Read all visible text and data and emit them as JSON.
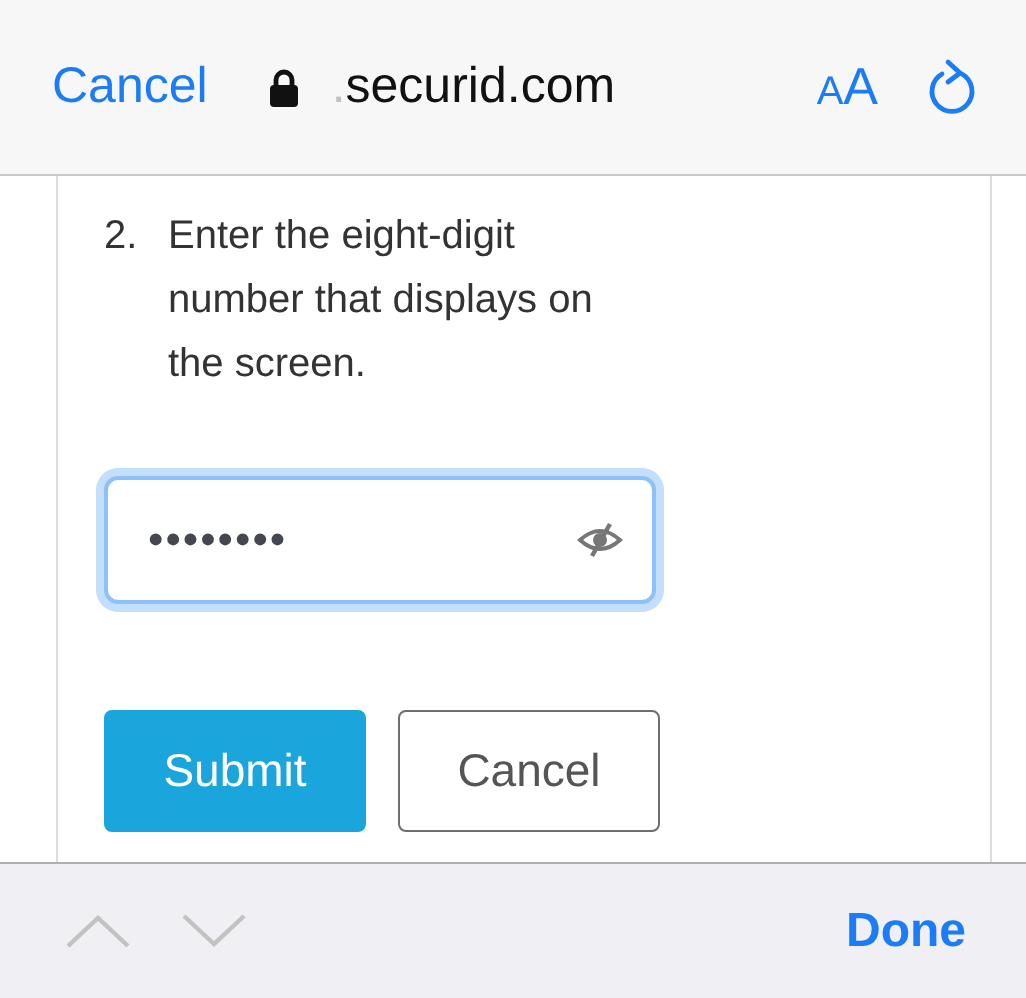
{
  "browser_bar": {
    "cancel": "Cancel",
    "domain_fade": ".",
    "domain": "securid.com",
    "text_size": {
      "small": "A",
      "large": "A"
    }
  },
  "step": {
    "number": "2.",
    "text": "Enter the eight-digit number that displays on the screen."
  },
  "password_field": {
    "value": "••••••••",
    "focused": true
  },
  "buttons": [
    {
      "label": "Submit",
      "kind": "primary"
    },
    {
      "label": "Cancel",
      "kind": "secondary"
    }
  ],
  "keyboard_bar": {
    "previous": {
      "disabled": true
    },
    "next": {
      "disabled": true
    },
    "done": "Done"
  }
}
